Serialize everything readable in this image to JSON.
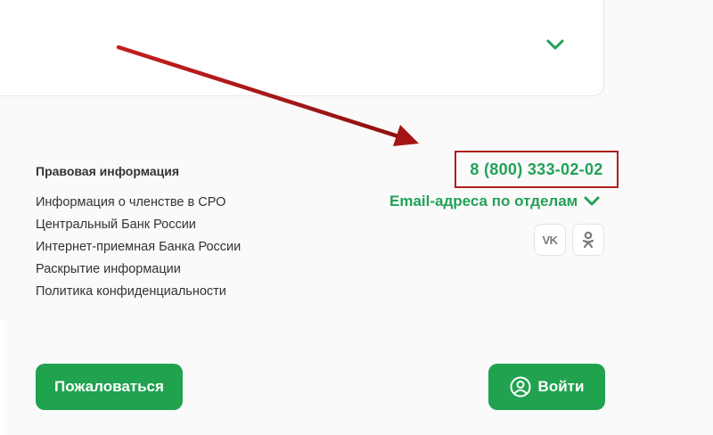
{
  "footer": {
    "legal_heading": "Правовая информация",
    "links": [
      "Информация о членстве в СРО",
      "Центральный Банк России",
      "Интернет-приемная Банка России",
      "Раскрытие информации",
      "Политика конфиденциальности"
    ]
  },
  "contacts": {
    "phone": "8 (800) 333-02-02",
    "email_label": "Email-адреса по отделам"
  },
  "social": {
    "vk_label": "VK",
    "ok_label": "ОК"
  },
  "buttons": {
    "complain": "Пожаловаться",
    "login": "Войти"
  },
  "colors": {
    "brand_green": "#21a24f",
    "link_green": "#22a158",
    "annotation_red": "#b01e1e"
  }
}
